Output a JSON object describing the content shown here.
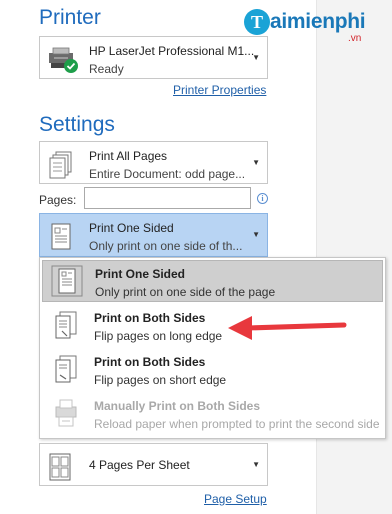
{
  "watermark": {
    "brand": "Taimienphi",
    "mark": "T",
    "name": "aimienphi",
    "tld": ".vn"
  },
  "printer": {
    "heading": "Printer",
    "name": "HP LaserJet Professional M1...",
    "status": "Ready",
    "properties_link": "Printer Properties"
  },
  "settings": {
    "heading": "Settings",
    "print_range": {
      "title": "Print All Pages",
      "subtitle": "Entire Document: odd page..."
    },
    "pages_label": "Pages:",
    "pages_value": "",
    "sides": {
      "title": "Print One Sided",
      "subtitle": "Only print on one side of th..."
    },
    "sides_options": [
      {
        "title": "Print One Sided",
        "subtitle": "Only print on one side of the page",
        "selected": true,
        "enabled": true,
        "icon": "one-sided-page-icon"
      },
      {
        "title": "Print on Both Sides",
        "subtitle": "Flip pages on long edge",
        "selected": false,
        "enabled": true,
        "icon": "duplex-long-edge-icon"
      },
      {
        "title": "Print on Both Sides",
        "subtitle": "Flip pages on short edge",
        "selected": false,
        "enabled": true,
        "icon": "duplex-short-edge-icon"
      },
      {
        "title": "Manually Print on Both Sides",
        "subtitle": "Reload paper when prompted to print the second side",
        "selected": false,
        "enabled": false,
        "icon": "manual-duplex-icon"
      }
    ],
    "per_sheet": {
      "title": "4 Pages Per Sheet"
    },
    "page_setup_link": "Page Setup"
  },
  "colors": {
    "accent": "#1f6bbd",
    "selected_combo": "#b8d4f3",
    "arrow": "#e8383d"
  }
}
